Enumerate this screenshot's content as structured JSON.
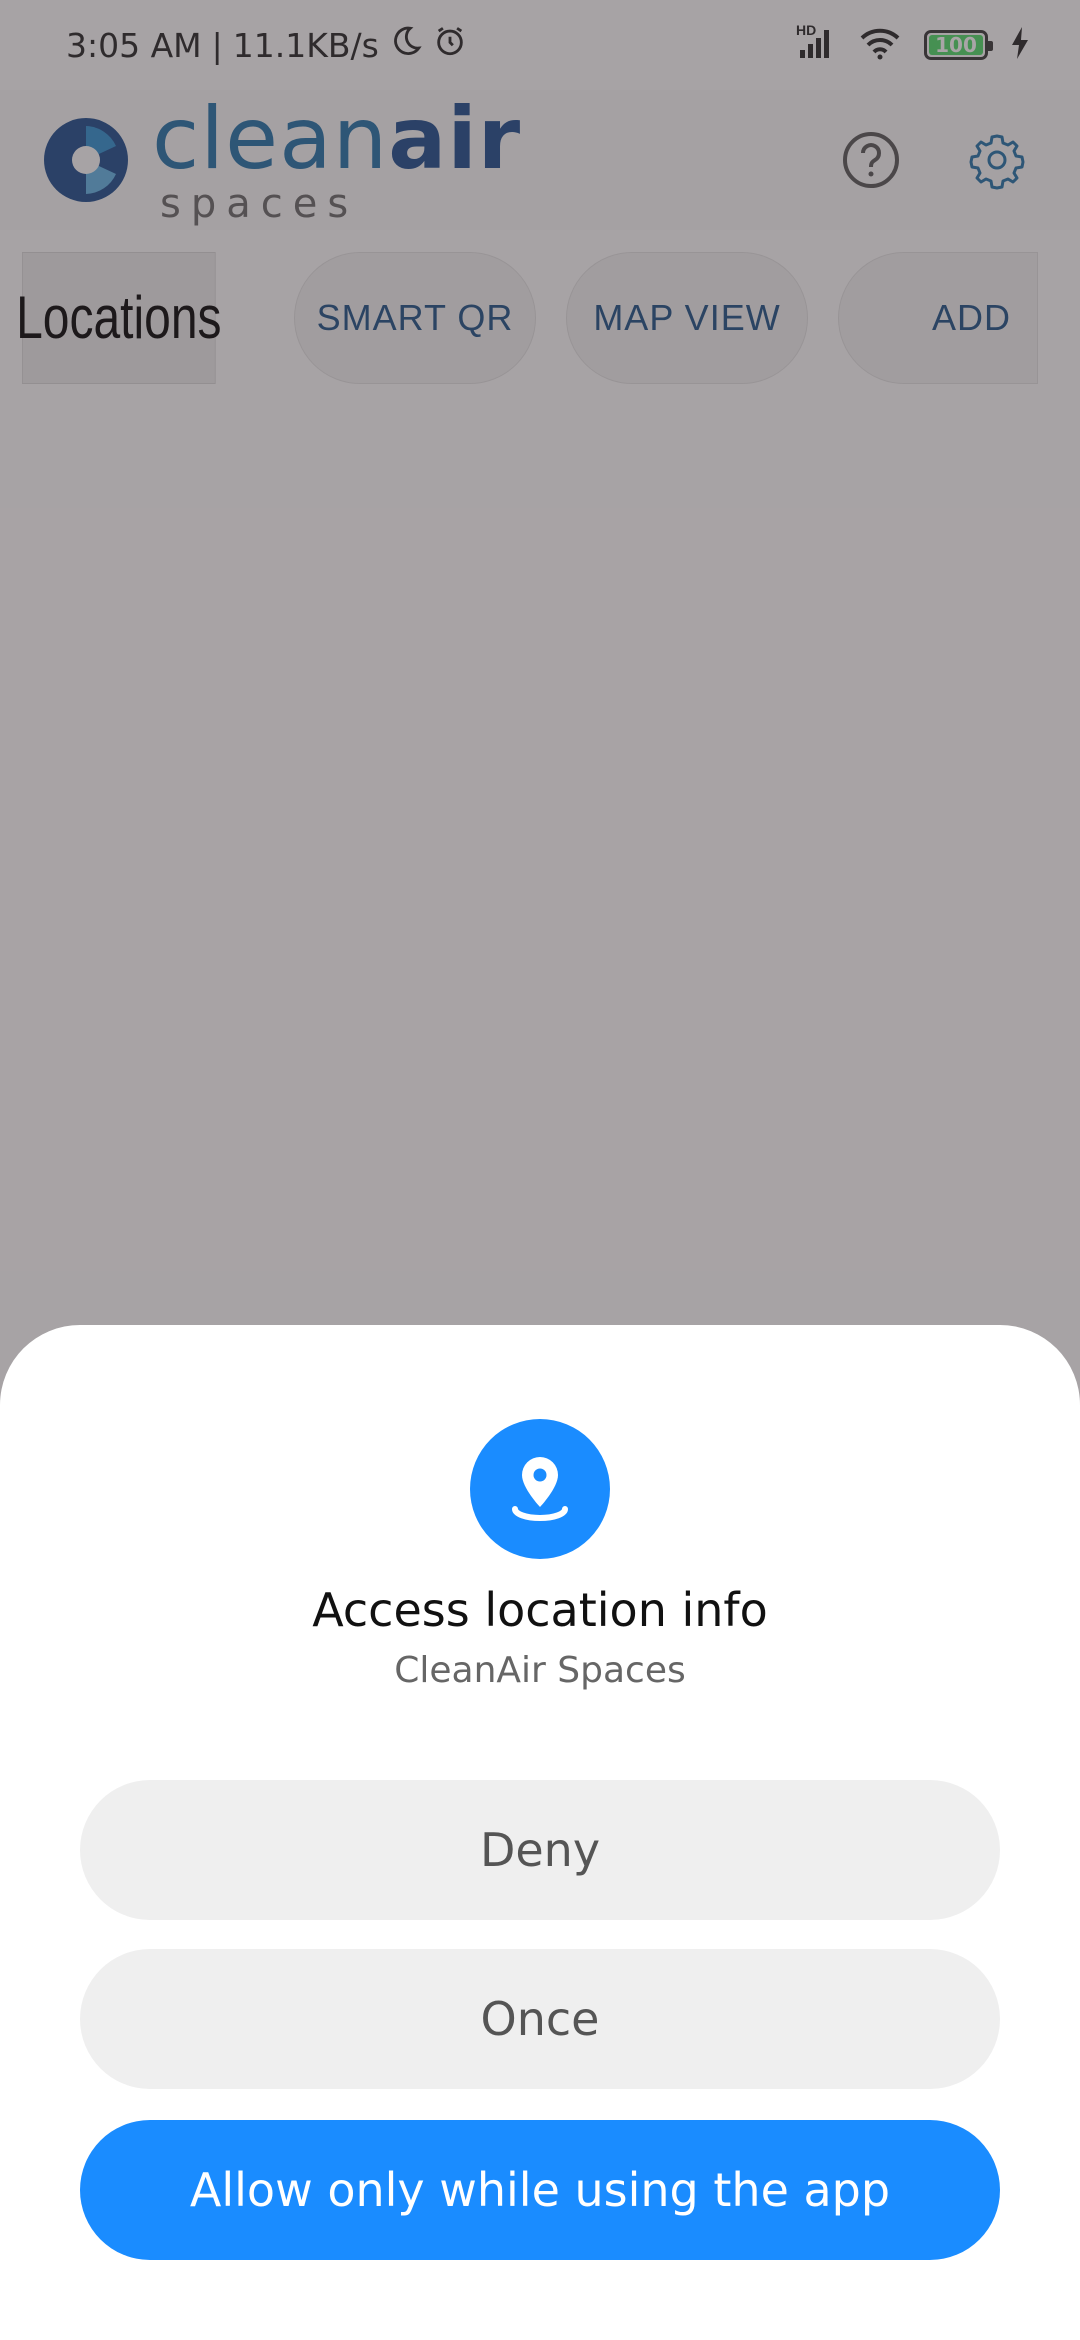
{
  "status_bar": {
    "time": "3:05 AM",
    "separator": "|",
    "net_speed": "11.1KB/s",
    "signal_label": "HD",
    "battery": "100"
  },
  "header": {
    "logo_word_light": "clean",
    "logo_word_bold": "air",
    "logo_subtitle": "spaces",
    "help_icon": "help-circle-icon",
    "settings_icon": "gear-icon"
  },
  "tabs": [
    {
      "label": "Locations",
      "active": true
    },
    {
      "label": "SMART QR",
      "active": false
    },
    {
      "label": "MAP VIEW",
      "active": false
    },
    {
      "label": "ADD",
      "active": false
    }
  ],
  "dialog": {
    "icon": "location-pin-icon",
    "title": "Access location info",
    "app_name": "CleanAir Spaces",
    "buttons": {
      "deny": "Deny",
      "once": "Once",
      "allow": "Allow only while using the app"
    }
  },
  "colors": {
    "accent": "#1a8cff",
    "brand_light": "#1f6fa6",
    "brand_dark": "#1b4a8a",
    "scrim": "#8f8c8e"
  }
}
